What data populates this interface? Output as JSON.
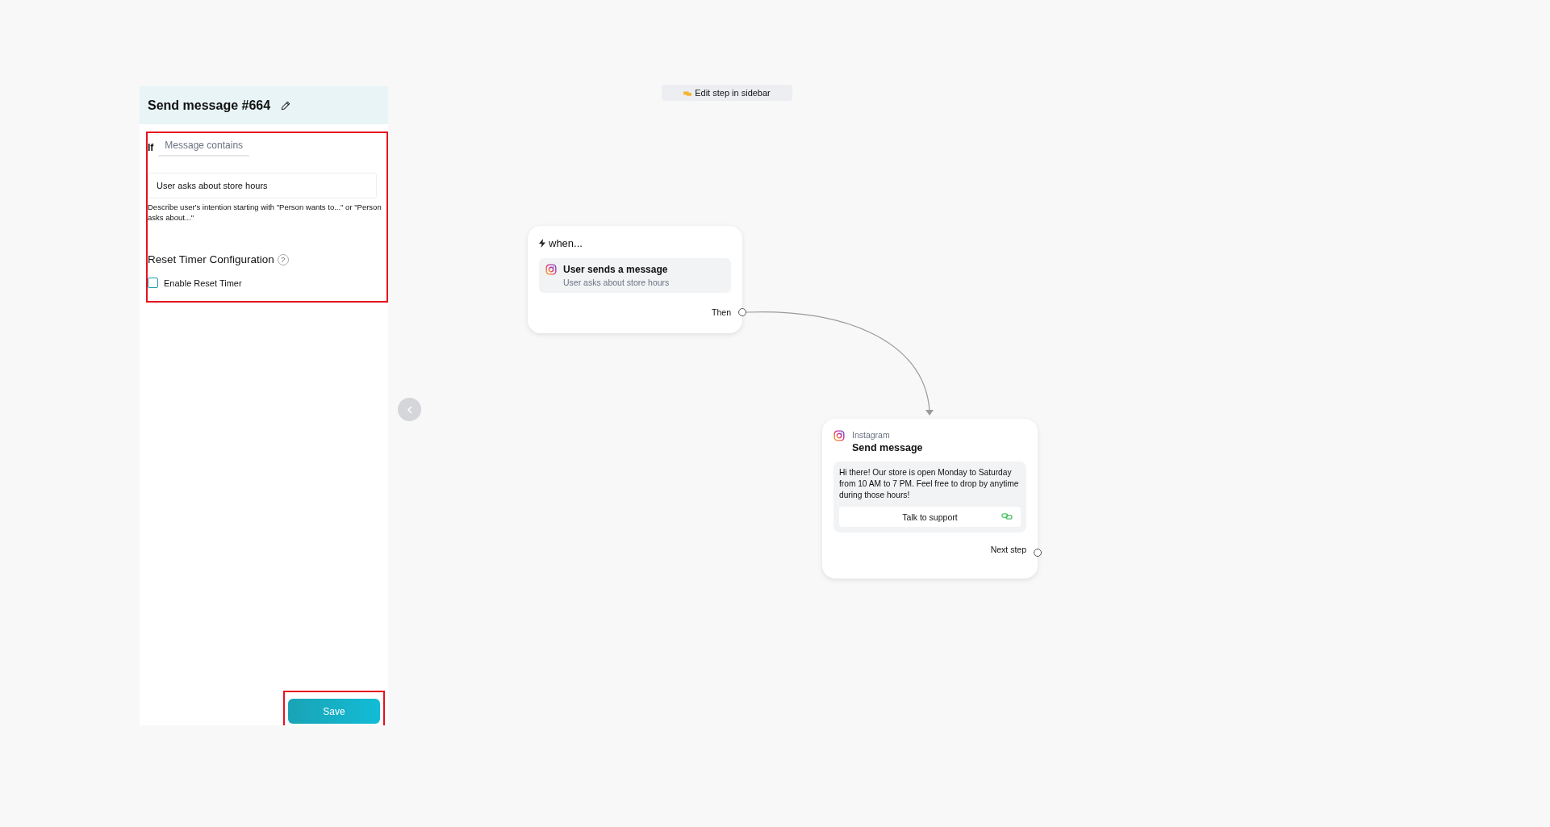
{
  "sidebar": {
    "title": "Send message #664",
    "condition": {
      "label": "If",
      "match_type": "Message contains",
      "value": "User asks about store hours",
      "hint": "Describe user's intention starting with \"Person wants to...\" or \"Person asks about...\""
    },
    "reset_timer": {
      "title": "Reset Timer Configuration",
      "help": "?",
      "checkbox": {
        "label": "Enable Reset Timer",
        "checked": false
      }
    },
    "save_button": "Save"
  },
  "canvas": {
    "hint": "Edit step in sidebar",
    "trigger": {
      "title": "when...",
      "event": "User sends a message",
      "detail": "User asks about store hours",
      "output": "Then"
    },
    "action": {
      "channel": "Instagram",
      "title": "Send message",
      "message": "Hi there! Our store is open Monday to Saturday from 10 AM to 7 PM. Feel free to drop by anytime during those hours!",
      "button": "Talk to support",
      "output": "Next step"
    }
  }
}
